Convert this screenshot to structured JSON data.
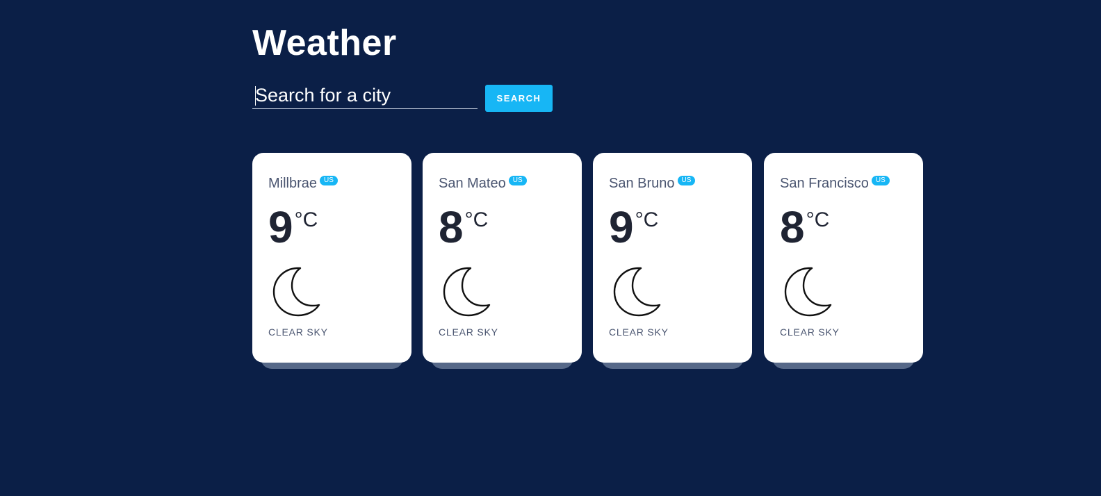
{
  "app": {
    "title": "Weather"
  },
  "search": {
    "placeholder": "Search for a city",
    "value": "",
    "button_label": "SEARCH"
  },
  "colors": {
    "background": "#0b1f47",
    "accent": "#17b6f5",
    "card": "#ffffff",
    "card_shadow": "#566888"
  },
  "cards": [
    {
      "city": "Millbrae",
      "country": "US",
      "temp": "9",
      "unit": "°C",
      "icon": "moon-icon",
      "condition": "CLEAR SKY"
    },
    {
      "city": "San Mateo",
      "country": "US",
      "temp": "8",
      "unit": "°C",
      "icon": "moon-icon",
      "condition": "CLEAR SKY"
    },
    {
      "city": "San Bruno",
      "country": "US",
      "temp": "9",
      "unit": "°C",
      "icon": "moon-icon",
      "condition": "CLEAR SKY"
    },
    {
      "city": "San Francisco",
      "country": "US",
      "temp": "8",
      "unit": "°C",
      "icon": "moon-icon",
      "condition": "CLEAR SKY"
    }
  ]
}
